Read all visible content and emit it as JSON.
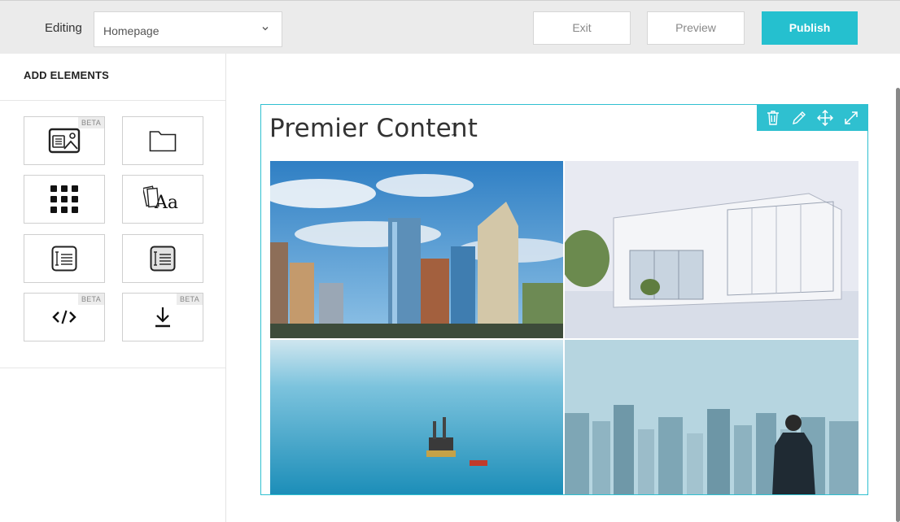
{
  "topbar": {
    "editing_label": "Editing",
    "page_select_value": "Homepage",
    "exit_label": "Exit",
    "preview_label": "Preview",
    "publish_label": "Publish"
  },
  "sidebar": {
    "title": "ADD ELEMENTS",
    "tiles": [
      {
        "name": "image-text",
        "badge": "BETA"
      },
      {
        "name": "folder",
        "badge": ""
      },
      {
        "name": "grid",
        "badge": ""
      },
      {
        "name": "typography",
        "badge": ""
      },
      {
        "name": "text-block",
        "badge": ""
      },
      {
        "name": "text-block-filled",
        "badge": ""
      },
      {
        "name": "code",
        "badge": "BETA"
      },
      {
        "name": "download",
        "badge": "BETA"
      }
    ]
  },
  "content": {
    "title": "Premier Content",
    "toolbar": [
      "trash-icon",
      "pencil-icon",
      "move-icon",
      "expand-icon"
    ],
    "images": [
      "city-skyline-photo",
      "modern-house-render-photo",
      "ocean-oil-rig-photo",
      "businessman-skyline-photo"
    ]
  },
  "colors": {
    "accent": "#25c0cf",
    "topbar_bg": "#ebebeb",
    "border": "#d6d6d6"
  }
}
